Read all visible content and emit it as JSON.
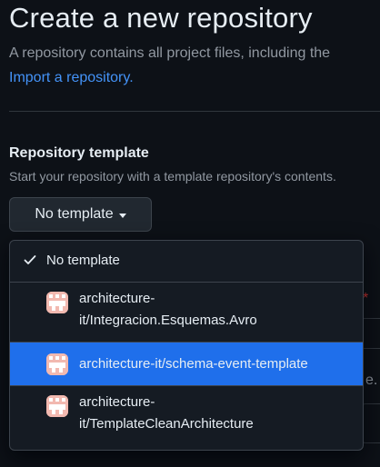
{
  "page": {
    "title": "Create a new repository",
    "subtitle": "A repository contains all project files, including the",
    "import_link": "Import a repository",
    "import_suffix": "."
  },
  "template_section": {
    "title": "Repository template",
    "description": "Start your repository with a template repository's contents.",
    "button_label": "No template"
  },
  "background": {
    "required_marker": "*",
    "trailing_text": "e."
  },
  "dropdown": {
    "none_option": "No template",
    "selected_index": 2,
    "items": [
      {
        "line1": "architecture-",
        "line2": "it/Integracion.Esquemas.Avro"
      },
      {
        "line1": "architecture-it/schema-event-template",
        "line2": ""
      },
      {
        "line1": "architecture-",
        "line2": "it/TemplateCleanArchitecture"
      }
    ]
  },
  "colors": {
    "background": "#0d1117",
    "link": "#4493f8",
    "highlight": "#1f6feb",
    "avatar": "#f2b9b0",
    "required": "#da3633"
  },
  "icons": {
    "check": "check-icon",
    "caret": "caret-down-icon",
    "avatar": "identicon-avatar"
  }
}
